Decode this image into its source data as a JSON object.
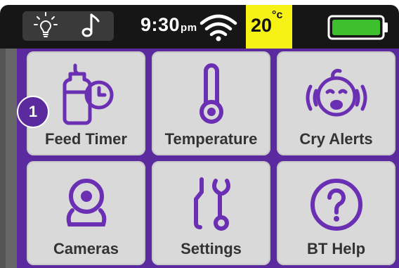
{
  "status_bar": {
    "icons": [
      "lightbulb-icon",
      "music-note-icon",
      "wifi-icon",
      "battery-icon"
    ],
    "time": "9:30",
    "time_suffix": "pm",
    "temperature": "20",
    "temperature_unit": "°c",
    "battery_level": 1.0
  },
  "colors": {
    "accent": "#5a2a9e",
    "tile_bg": "#d9d9d9",
    "temp_highlight": "#f6f216",
    "battery_fill": "#3dbf2e"
  },
  "badge": {
    "number": "1"
  },
  "tiles": [
    {
      "label": "Feed Timer",
      "icon": "bottle-clock-icon"
    },
    {
      "label": "Temperature",
      "icon": "thermometer-icon"
    },
    {
      "label": "Cry Alerts",
      "icon": "crying-baby-icon"
    },
    {
      "label": "Cameras",
      "icon": "camera-icon"
    },
    {
      "label": "Settings",
      "icon": "tools-icon"
    },
    {
      "label": "BT Help",
      "icon": "help-icon"
    }
  ]
}
